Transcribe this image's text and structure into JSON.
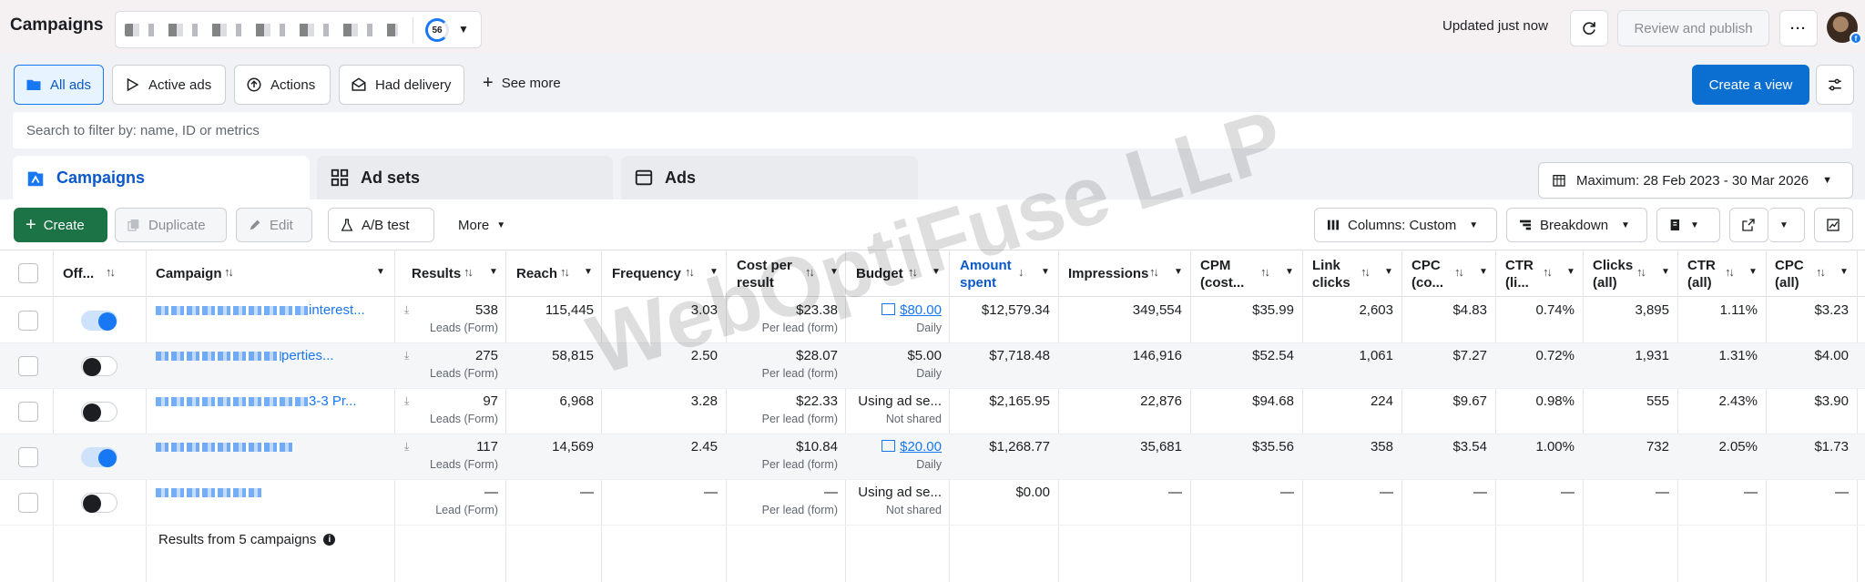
{
  "header": {
    "title": "Campaigns",
    "score": "56",
    "updated": "Updated just now",
    "review_label": "Review and publish",
    "more_label": "···"
  },
  "views": {
    "all_ads": "All ads",
    "active_ads": "Active ads",
    "actions": "Actions",
    "had_delivery": "Had delivery",
    "see_more": "See more",
    "create_view": "Create a view"
  },
  "search": {
    "placeholder": "Search to filter by: name, ID or metrics"
  },
  "level_tabs": {
    "campaigns": "Campaigns",
    "ad_sets": "Ad sets",
    "ads": "Ads"
  },
  "date_range": "Maximum: 28 Feb 2023 - 30 Mar 2026",
  "toolbar": {
    "create": "Create",
    "duplicate": "Duplicate",
    "edit": "Edit",
    "ab_test": "A/B test",
    "more": "More",
    "columns": "Columns: Custom",
    "breakdown": "Breakdown"
  },
  "columns": {
    "off": "Off...",
    "campaign": "Campaign",
    "results": "Results",
    "reach": "Reach",
    "frequency": "Frequency",
    "cost_per_result_1": "Cost per",
    "cost_per_result_2": "result",
    "budget": "Budget",
    "amount_spent_1": "Amount",
    "amount_spent_2": "spent",
    "impressions": "Impressions",
    "cpm_1": "CPM",
    "cpm_2": "(cost...",
    "link_clicks_1": "Link",
    "link_clicks_2": "clicks",
    "cpc_1": "CPC",
    "cpc_2": "(co...",
    "ctr_link_1": "CTR",
    "ctr_link_2": "(li...",
    "clicks_all_1": "Clicks",
    "clicks_all_2": "(all)",
    "ctr_all_1": "CTR",
    "ctr_all_2": "(all)",
    "cpc_all_1": "CPC",
    "cpc_all_2": "(all)"
  },
  "rows": [
    {
      "on": true,
      "name_suffix": "interest...",
      "results": "538",
      "result_type": "Leads (Form)",
      "reach": "115,445",
      "frequency": "3.03",
      "cost_per_result": "$23.38",
      "cpr_sub": "Per lead (form)",
      "budget": "$80.00",
      "budget_sub": "Daily",
      "budget_link": true,
      "amount_spent": "$12,579.34",
      "impressions": "349,554",
      "cpm": "$35.99",
      "link_clicks": "2,603",
      "cpc": "$4.83",
      "ctr_link": "0.74%",
      "clicks_all": "3,895",
      "ctr_all": "1.11%",
      "cpc_all": "$3.23"
    },
    {
      "on": false,
      "name_suffix": "perties...",
      "results": "275",
      "result_type": "Leads (Form)",
      "reach": "58,815",
      "frequency": "2.50",
      "cost_per_result": "$28.07",
      "cpr_sub": "Per lead (form)",
      "budget": "$5.00",
      "budget_sub": "Daily",
      "budget_link": false,
      "amount_spent": "$7,718.48",
      "impressions": "146,916",
      "cpm": "$52.54",
      "link_clicks": "1,061",
      "cpc": "$7.27",
      "ctr_link": "0.72%",
      "clicks_all": "1,931",
      "ctr_all": "1.31%",
      "cpc_all": "$4.00"
    },
    {
      "on": false,
      "name_suffix": "3-3 Pr...",
      "results": "97",
      "result_type": "Leads (Form)",
      "reach": "6,968",
      "frequency": "3.28",
      "cost_per_result": "$22.33",
      "cpr_sub": "Per lead (form)",
      "budget": "Using ad se...",
      "budget_sub": "Not shared",
      "budget_link": false,
      "amount_spent": "$2,165.95",
      "impressions": "22,876",
      "cpm": "$94.68",
      "link_clicks": "224",
      "cpc": "$9.67",
      "ctr_link": "0.98%",
      "clicks_all": "555",
      "ctr_all": "2.43%",
      "cpc_all": "$3.90"
    },
    {
      "on": true,
      "name_suffix": "",
      "results": "117",
      "result_type": "Leads (Form)",
      "reach": "14,569",
      "frequency": "2.45",
      "cost_per_result": "$10.84",
      "cpr_sub": "Per lead (form)",
      "budget": "$20.00",
      "budget_sub": "Daily",
      "budget_link": true,
      "amount_spent": "$1,268.77",
      "impressions": "35,681",
      "cpm": "$35.56",
      "link_clicks": "358",
      "cpc": "$3.54",
      "ctr_link": "1.00%",
      "clicks_all": "732",
      "ctr_all": "2.05%",
      "cpc_all": "$1.73"
    },
    {
      "on": false,
      "name_suffix": "",
      "results": "—",
      "result_type": "Lead (Form)",
      "reach": "—",
      "frequency": "—",
      "cost_per_result": "—",
      "cpr_sub": "Per lead (form)",
      "budget": "Using ad se...",
      "budget_sub": "Not shared",
      "budget_link": false,
      "amount_spent": "$0.00",
      "impressions": "—",
      "cpm": "—",
      "link_clicks": "—",
      "cpc": "—",
      "ctr_link": "—",
      "clicks_all": "—",
      "ctr_all": "—",
      "cpc_all": "—"
    }
  ],
  "footer": {
    "results_text": "Results from 5 campaigns"
  },
  "watermark": "WebOptiFuse LLP",
  "colors": {
    "primary": "#0b6fd1",
    "create_green": "#1b7346",
    "link": "#1877f2"
  }
}
